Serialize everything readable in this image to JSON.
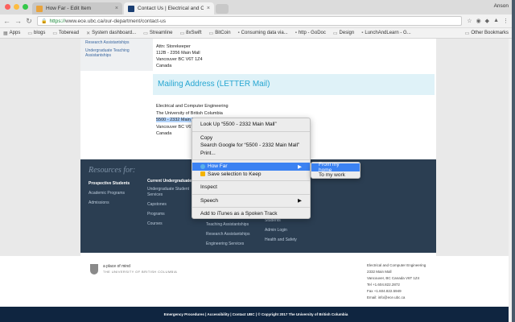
{
  "browser": {
    "tabs": [
      {
        "title": "How Far - Edit Item",
        "favicon_color": "#e8a33d",
        "active": false
      },
      {
        "title": "Contact Us | Electrical and C",
        "favicon_color": "#1b3f73",
        "active": true
      }
    ],
    "profile": "Anson",
    "url_secure": "https://",
    "url": "www.ece.ubc.ca/our-department/contact-us"
  },
  "bookmarks": [
    {
      "label": "Apps",
      "icon": "apps-grid-icon"
    },
    {
      "label": "blogs",
      "icon": "folder-icon"
    },
    {
      "label": "Toberead",
      "icon": "folder-icon"
    },
    {
      "label": "System dashboard...",
      "icon": "jira-icon"
    },
    {
      "label": "Streamline",
      "icon": "folder-icon"
    },
    {
      "label": "8xSwift",
      "icon": "folder-icon"
    },
    {
      "label": "BitCoin",
      "icon": "folder-icon"
    },
    {
      "label": "Consuming data via...",
      "icon": "page-icon"
    },
    {
      "label": "http - GoDoc",
      "icon": "page-icon"
    },
    {
      "label": "Design",
      "icon": "folder-icon"
    },
    {
      "label": "LunchAndLearn - G...",
      "icon": "page-icon"
    }
  ],
  "other_bookmarks": "Other Bookmarks",
  "left_nav": [
    "Research Assistantships",
    "Undergraduate Teaching Assistantships"
  ],
  "address_top": [
    "Attn: Storekeeper",
    "112B - 2356 Main Mall",
    "Vancouver BC V6T 1Z4",
    "Canada"
  ],
  "mailing_heading": "Mailing Address (LETTER Mail)",
  "address_mail": [
    "Electrical and Computer Engineering",
    "The University of British Columbia"
  ],
  "address_selected": "5500 - 2332 Main Mall",
  "address_mail_rest": [
    "Vancouver BC V6T",
    "Canada"
  ],
  "resources": {
    "title": "Resources for:",
    "prospective": {
      "heading": "Prospective Students",
      "items": [
        "Academic Programs",
        "Admissions"
      ]
    },
    "undergrad": {
      "heading": "Current Undergraduate",
      "items": [
        "Undergraduate Student Services",
        "Capstones",
        "Programs",
        "Courses"
      ]
    },
    "col3": [
      "Teaching Assistantships",
      "Research Assistantships",
      "Engineering Services"
    ],
    "col4": [
      "Students",
      "Admin Login",
      "Health and Safety"
    ]
  },
  "footer": {
    "tagline": "a place of mind",
    "university": "THE UNIVERSITY OF BRITISH COLUMBIA",
    "address": [
      "Electrical and Computer Engineering",
      "2332 Main Mall",
      "Vancouver, BC Canada V6T 1Z4",
      "Tel +1.604.822.2872",
      "Fax +1.604.822.5949",
      "Email: info@ece.ubc.ca"
    ],
    "copyright": "Emergency Procedures | Accessibility | Contact UBC | © Copyright 2017 The University of British Columbia"
  },
  "context_menu": {
    "lookup": "Look Up “5500 - 2332 Main Mall”",
    "copy": "Copy",
    "search": "Search Google for “5500 - 2332 Main Mall”",
    "print": "Print...",
    "howfar": "How Far",
    "keep": "Save selection to Keep",
    "inspect": "Inspect",
    "speech": "Speech",
    "itunes": "Add to iTunes as a Spoken Track"
  },
  "submenu": {
    "from_home": "From my home",
    "to_work": "To my work"
  }
}
